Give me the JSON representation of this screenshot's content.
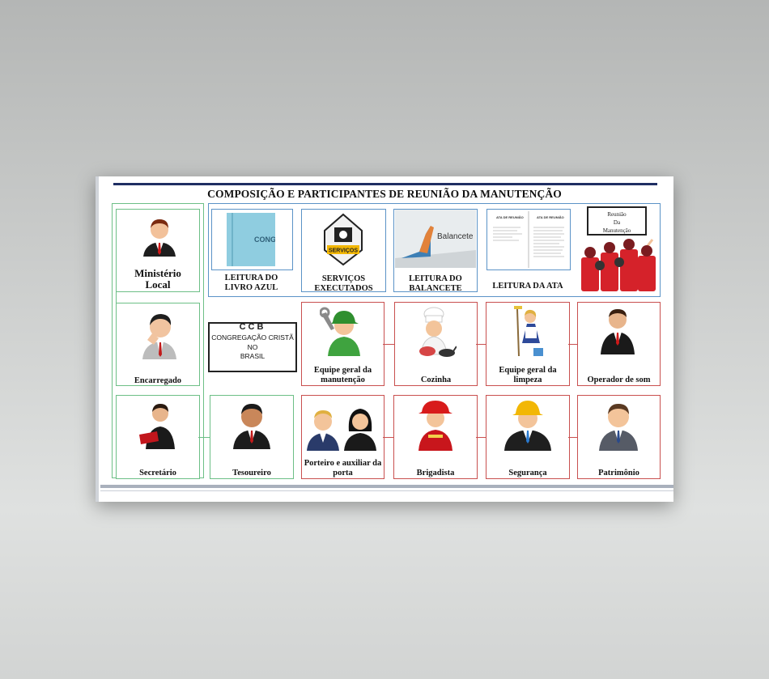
{
  "title": "COMPOSIÇÃO E PARTICIPANTES DE REUNIÃO DA MANUTENÇÃO",
  "cards": {
    "ministerio": "Ministério Local",
    "livro_azul": "LEITURA DO LIVRO AZUL",
    "livro_azul_img": "CONG",
    "servicos": "SERVIÇOS EXECUTADOS",
    "servicos_img": "SERVIÇOS",
    "balancete": "LEITURA DO BALANCETE",
    "balancete_img": "Balancete",
    "ata": "LEITURA DA ATA",
    "ata_img_left": "ATA DE REUNIÃO",
    "ata_img_right": "ATA DE REUNIÃO",
    "reuniao_sign": [
      "Reunião",
      "Da",
      "Manutenção"
    ],
    "encarregado": "Encarregado",
    "ccb_top": "CCB",
    "ccb_line1": "CONGREGAÇÃO CRISTÃ",
    "ccb_line2": "NO",
    "ccb_line3": "BRASIL",
    "equipe_manutencao": "Equipe geral da manutenção",
    "cozinha": "Cozinha",
    "equipe_limpeza": "Equipe geral da limpeza",
    "operador_som": "Operador de som",
    "secretario": "Secretário",
    "tesoureiro": "Tesoureiro",
    "porteiro": "Porteiro e auxiliar da porta",
    "brigadista": "Brigadista",
    "seguranca": "Segurança",
    "patrimonio": "Patrimônio"
  },
  "colors": {
    "green_border": "#6dbf86",
    "blue_border": "#5b93c7",
    "red_border": "#c9504f",
    "title_line": "#1f2e63"
  }
}
